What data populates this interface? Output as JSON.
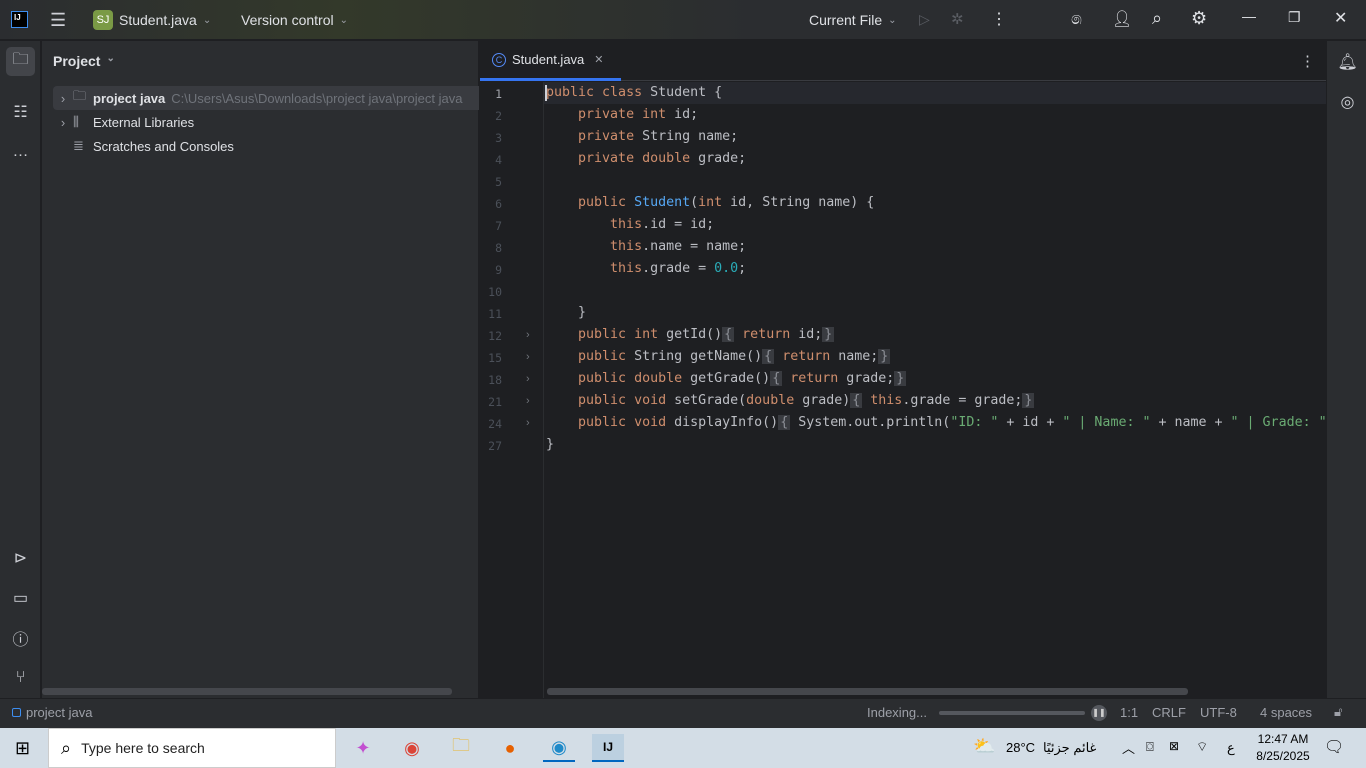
{
  "titlebar": {
    "project_badge": "SJ",
    "project_name": "Student.java",
    "vcs": "Version control",
    "run_config": "Current File"
  },
  "project_panel": {
    "title": "Project",
    "items": [
      {
        "label": "project java",
        "path": "C:\\Users\\Asus\\Downloads\\project java\\project java"
      },
      {
        "label": "External Libraries"
      },
      {
        "label": "Scratches and Consoles"
      }
    ]
  },
  "editor": {
    "tab": "Student.java",
    "line_numbers": [
      "1",
      "2",
      "3",
      "4",
      "5",
      "6",
      "7",
      "8",
      "9",
      "10",
      "11",
      "12",
      "15",
      "18",
      "21",
      "24",
      "27"
    ],
    "lines": [
      [
        [
          "kw",
          "public "
        ],
        [
          "kw",
          "class "
        ],
        [
          "p",
          "Student {"
        ]
      ],
      [
        [
          "p",
          "    "
        ],
        [
          "kw",
          "private "
        ],
        [
          "kw",
          "int "
        ],
        [
          "p",
          "id;"
        ]
      ],
      [
        [
          "p",
          "    "
        ],
        [
          "kw",
          "private "
        ],
        [
          "p",
          "String name;"
        ]
      ],
      [
        [
          "p",
          "    "
        ],
        [
          "kw",
          "private "
        ],
        [
          "kw",
          "double "
        ],
        [
          "p",
          "grade;"
        ]
      ],
      [],
      [
        [
          "p",
          "    "
        ],
        [
          "kw",
          "public "
        ],
        [
          "fn",
          "Student"
        ],
        [
          "p",
          "("
        ],
        [
          "kw",
          "int "
        ],
        [
          "p",
          "id, String name) {"
        ]
      ],
      [
        [
          "p",
          "        "
        ],
        [
          "kw",
          "this"
        ],
        [
          "p",
          ".id = id;"
        ]
      ],
      [
        [
          "p",
          "        "
        ],
        [
          "kw",
          "this"
        ],
        [
          "p",
          ".name = name;"
        ]
      ],
      [
        [
          "p",
          "        "
        ],
        [
          "kw",
          "this"
        ],
        [
          "p",
          ".grade = "
        ],
        [
          "num",
          "0.0"
        ],
        [
          "p",
          ";"
        ]
      ],
      [],
      [
        [
          "p",
          "    }"
        ]
      ],
      [
        [
          "p",
          "    "
        ],
        [
          "kw",
          "public "
        ],
        [
          "kw",
          "int "
        ],
        [
          "p",
          "getId()"
        ],
        [
          "fold",
          "{"
        ],
        [
          "kw",
          " return "
        ],
        [
          "p",
          "id;"
        ],
        [
          "fold",
          "}"
        ]
      ],
      [
        [
          "p",
          "    "
        ],
        [
          "kw",
          "public "
        ],
        [
          "p",
          "String getName()"
        ],
        [
          "fold",
          "{"
        ],
        [
          "kw",
          " return "
        ],
        [
          "p",
          "name;"
        ],
        [
          "fold",
          "}"
        ]
      ],
      [
        [
          "p",
          "    "
        ],
        [
          "kw",
          "public "
        ],
        [
          "kw",
          "double "
        ],
        [
          "p",
          "getGrade()"
        ],
        [
          "fold",
          "{"
        ],
        [
          "kw",
          " return "
        ],
        [
          "p",
          "grade;"
        ],
        [
          "fold",
          "}"
        ]
      ],
      [
        [
          "p",
          "    "
        ],
        [
          "kw",
          "public "
        ],
        [
          "kw",
          "void "
        ],
        [
          "p",
          "setGrade("
        ],
        [
          "kw",
          "double "
        ],
        [
          "p",
          "grade)"
        ],
        [
          "fold",
          "{"
        ],
        [
          "kw",
          " this"
        ],
        [
          "p",
          ".grade = grade;"
        ],
        [
          "fold",
          "}"
        ]
      ],
      [
        [
          "p",
          "    "
        ],
        [
          "kw",
          "public "
        ],
        [
          "kw",
          "void "
        ],
        [
          "p",
          "displayInfo()"
        ],
        [
          "fold",
          "{"
        ],
        [
          "p",
          " System.out.println("
        ],
        [
          "str",
          "\"ID: \""
        ],
        [
          "p",
          " + id + "
        ],
        [
          "str",
          "\" | Name: \""
        ],
        [
          "p",
          " + name + "
        ],
        [
          "str",
          "\" | Grade: \""
        ]
      ],
      [
        [
          "p",
          "}"
        ]
      ]
    ]
  },
  "statusbar": {
    "breadcrumb": "project java",
    "indexing": "Indexing...",
    "indexing_progress": 0,
    "position": "1:1",
    "line_sep": "CRLF",
    "encoding": "UTF-8",
    "indent": "4 spaces"
  },
  "taskbar": {
    "search_placeholder": "Type here to search",
    "temperature": "28°C",
    "weather": "غائم جزئيًا",
    "lang": "ع",
    "time": "12:47 AM",
    "date": "8/25/2025"
  }
}
